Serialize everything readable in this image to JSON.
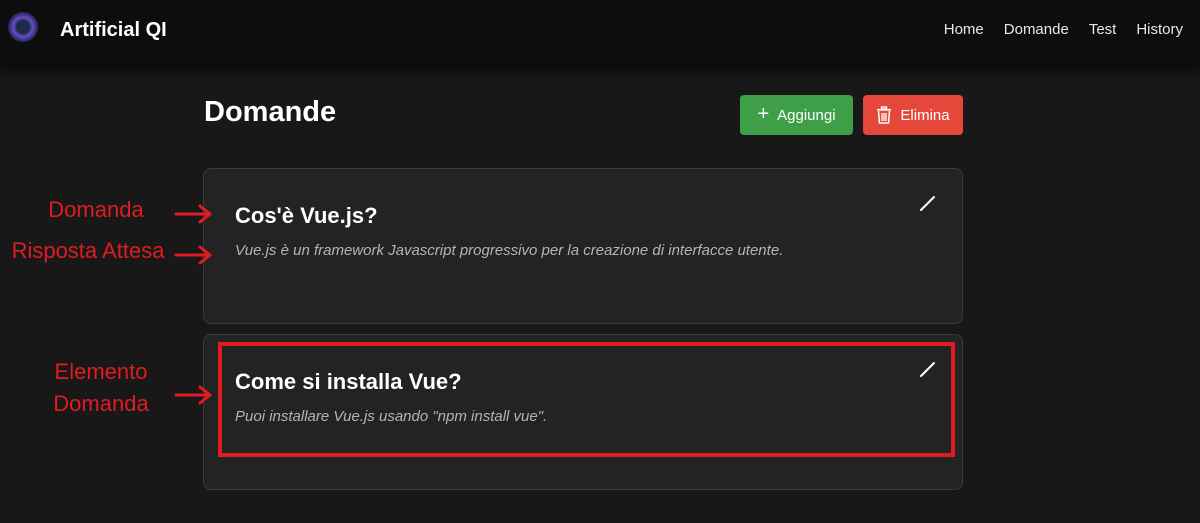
{
  "app": {
    "brand": "Artificial QI"
  },
  "nav": {
    "items": [
      "Home",
      "Domande",
      "Test",
      "History"
    ]
  },
  "page": {
    "title": "Domande",
    "add_label": "Aggiungi",
    "delete_label": "Elimina"
  },
  "questions": [
    {
      "question": "Cos'è Vue.js?",
      "answer": "Vue.js è un framework Javascript progressivo per la creazione di interfacce utente."
    },
    {
      "question": "Come si installa Vue?",
      "answer": "Puoi installare Vue.js usando \"npm install vue\"."
    }
  ],
  "annotations": {
    "question": "Domanda",
    "answer": "Risposta Attesa",
    "element_line1": "Elemento",
    "element_line2": "Domanda"
  },
  "colors": {
    "add_button": "#3e9f48",
    "delete_button": "#e5473b",
    "annotation": "#e01b22",
    "background": "#181818",
    "card": "#232323"
  },
  "icons": [
    "logo-icon",
    "plus-icon",
    "trash-icon",
    "edit-pencil-icon",
    "arrow-right-icon"
  ]
}
